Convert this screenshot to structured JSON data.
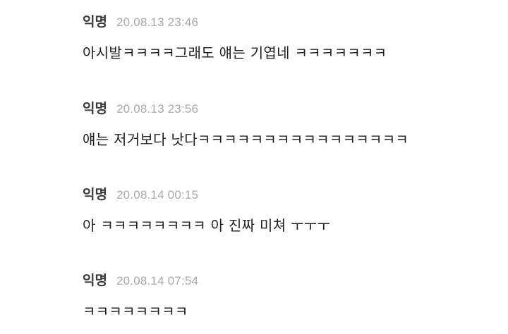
{
  "comments": [
    {
      "author": "익명",
      "time": "20.08.13 23:46",
      "text": "아시발ㅋㅋㅋㅋ그래도 얘는 기엽네 ㅋㅋㅋㅋㅋㅋㅋ"
    },
    {
      "author": "익명",
      "time": "20.08.13 23:56",
      "text": "얘는 저거보다 낫다ㅋㅋㅋㅋㅋㅋㅋㅋㅋㅋㅋㅋㅋㅋㅋㅋ"
    },
    {
      "author": "익명",
      "time": "20.08.14 00:15",
      "text": "아 ㅋㅋㅋㅋㅋㅋㅋㅋ 아 진짜 미쳐 ㅜㅜㅜ"
    },
    {
      "author": "익명",
      "time": "20.08.14 07:54",
      "text": "ㅋㅋㅋㅋㅋㅋㅋㅋ"
    }
  ]
}
